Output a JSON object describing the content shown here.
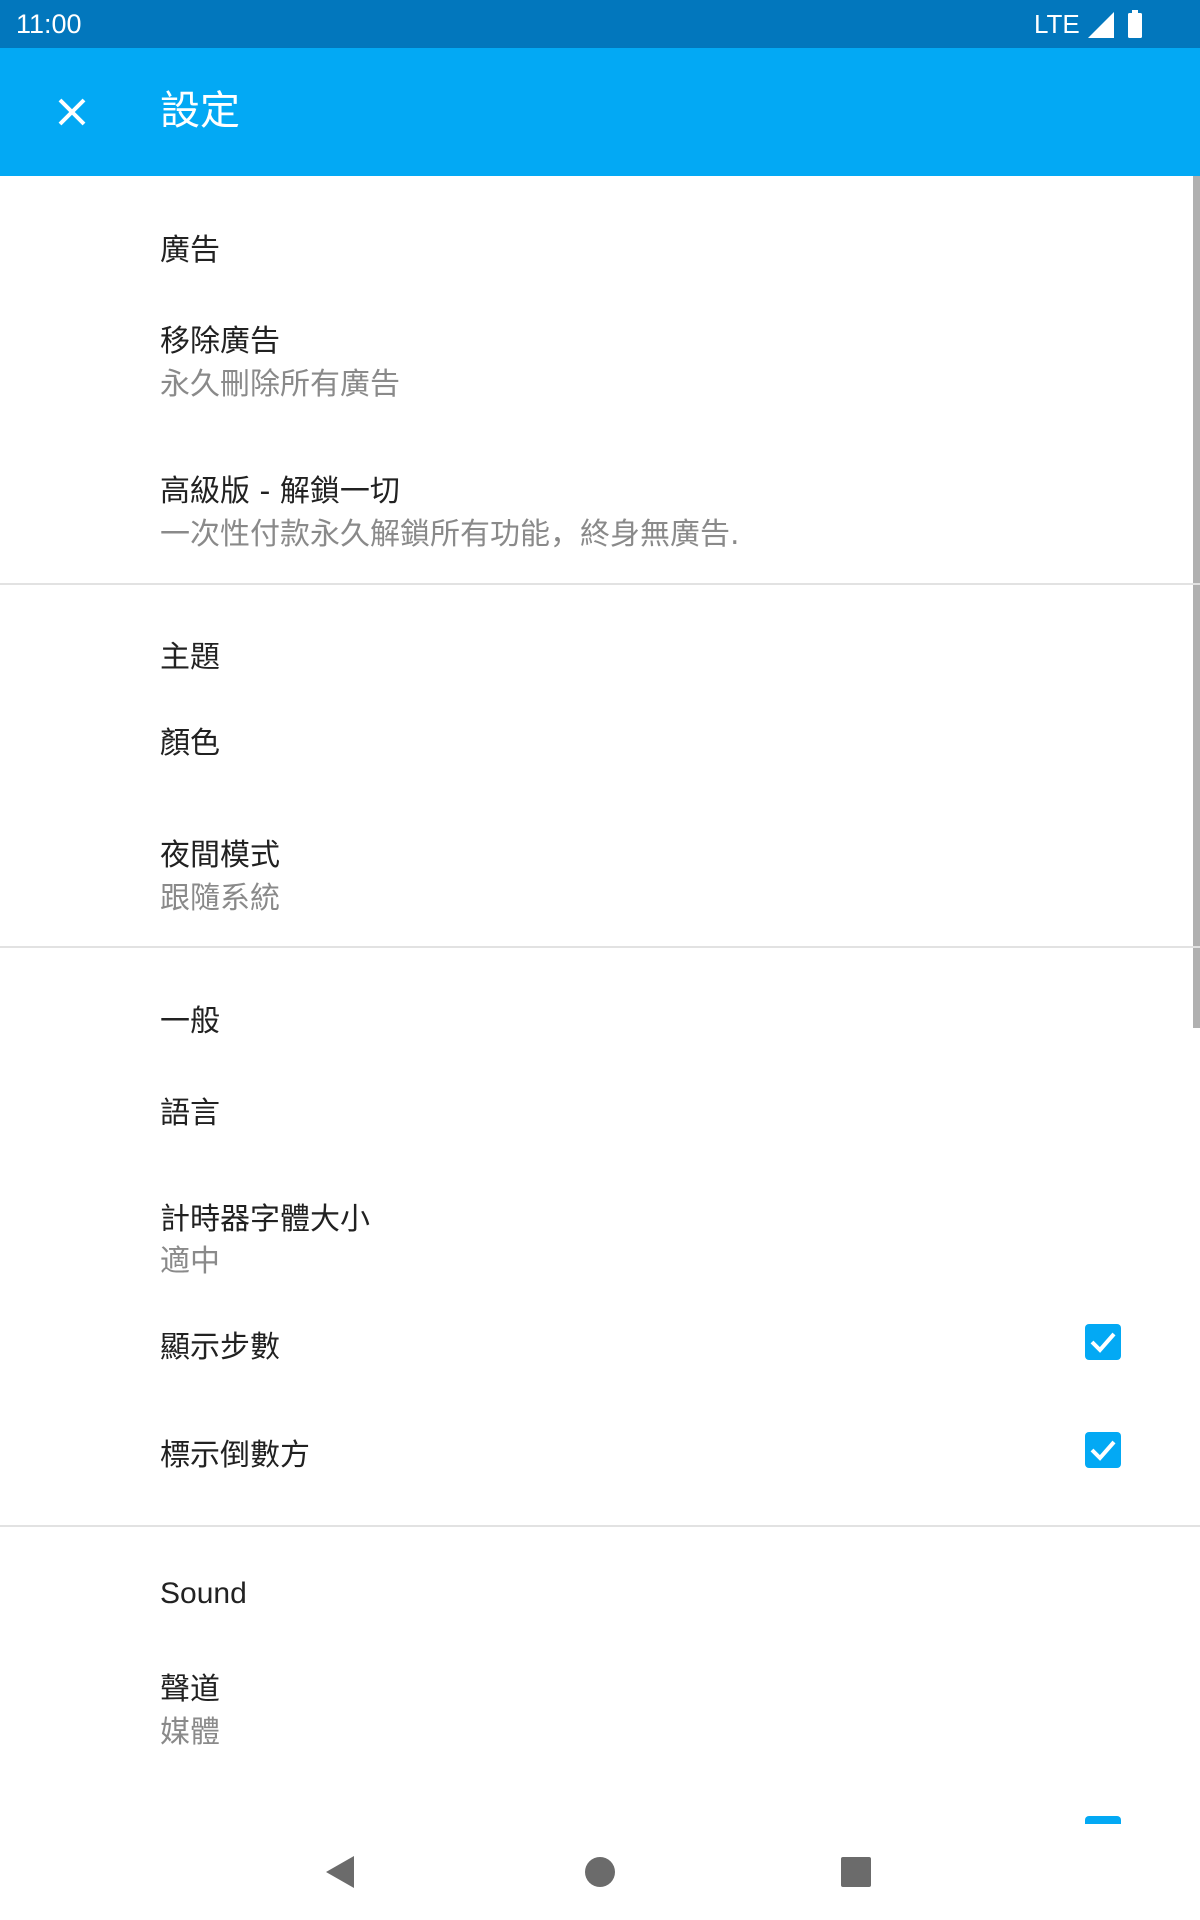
{
  "status_bar": {
    "time": "11:00",
    "network": "LTE",
    "icons": [
      "signal-icon",
      "battery-icon"
    ]
  },
  "app_bar": {
    "title": "設定",
    "close_icon": "close-icon",
    "color": "#03a9f4"
  },
  "sections": {
    "ads": {
      "header": "廣告",
      "remove_ads": {
        "title": "移除廣告",
        "summary": "永久刪除所有廣告"
      },
      "premium": {
        "title": "高級版 - 解鎖一切",
        "summary": "一次性付款永久解鎖所有功能，終身無廣告."
      }
    },
    "theme": {
      "header": "主題",
      "color": {
        "title": "顏色"
      },
      "night_mode": {
        "title": "夜間模式",
        "summary": "跟隨系統"
      }
    },
    "general": {
      "header": "一般",
      "language": {
        "title": "語言"
      },
      "timer_font_size": {
        "title": "計時器字體大小",
        "summary": "適中"
      },
      "show_steps": {
        "title": "顯示步數",
        "checked": true
      },
      "mark_countdown": {
        "title": "標示倒數方",
        "checked": true
      }
    },
    "sound": {
      "header": "Sound",
      "channel": {
        "title": "聲道",
        "summary": "媒體"
      }
    }
  },
  "colors": {
    "accent": "#03a9f4",
    "status_bar": "#0277bd"
  },
  "nav_bar": {
    "icons": [
      "back-icon",
      "home-icon",
      "recents-icon"
    ]
  }
}
